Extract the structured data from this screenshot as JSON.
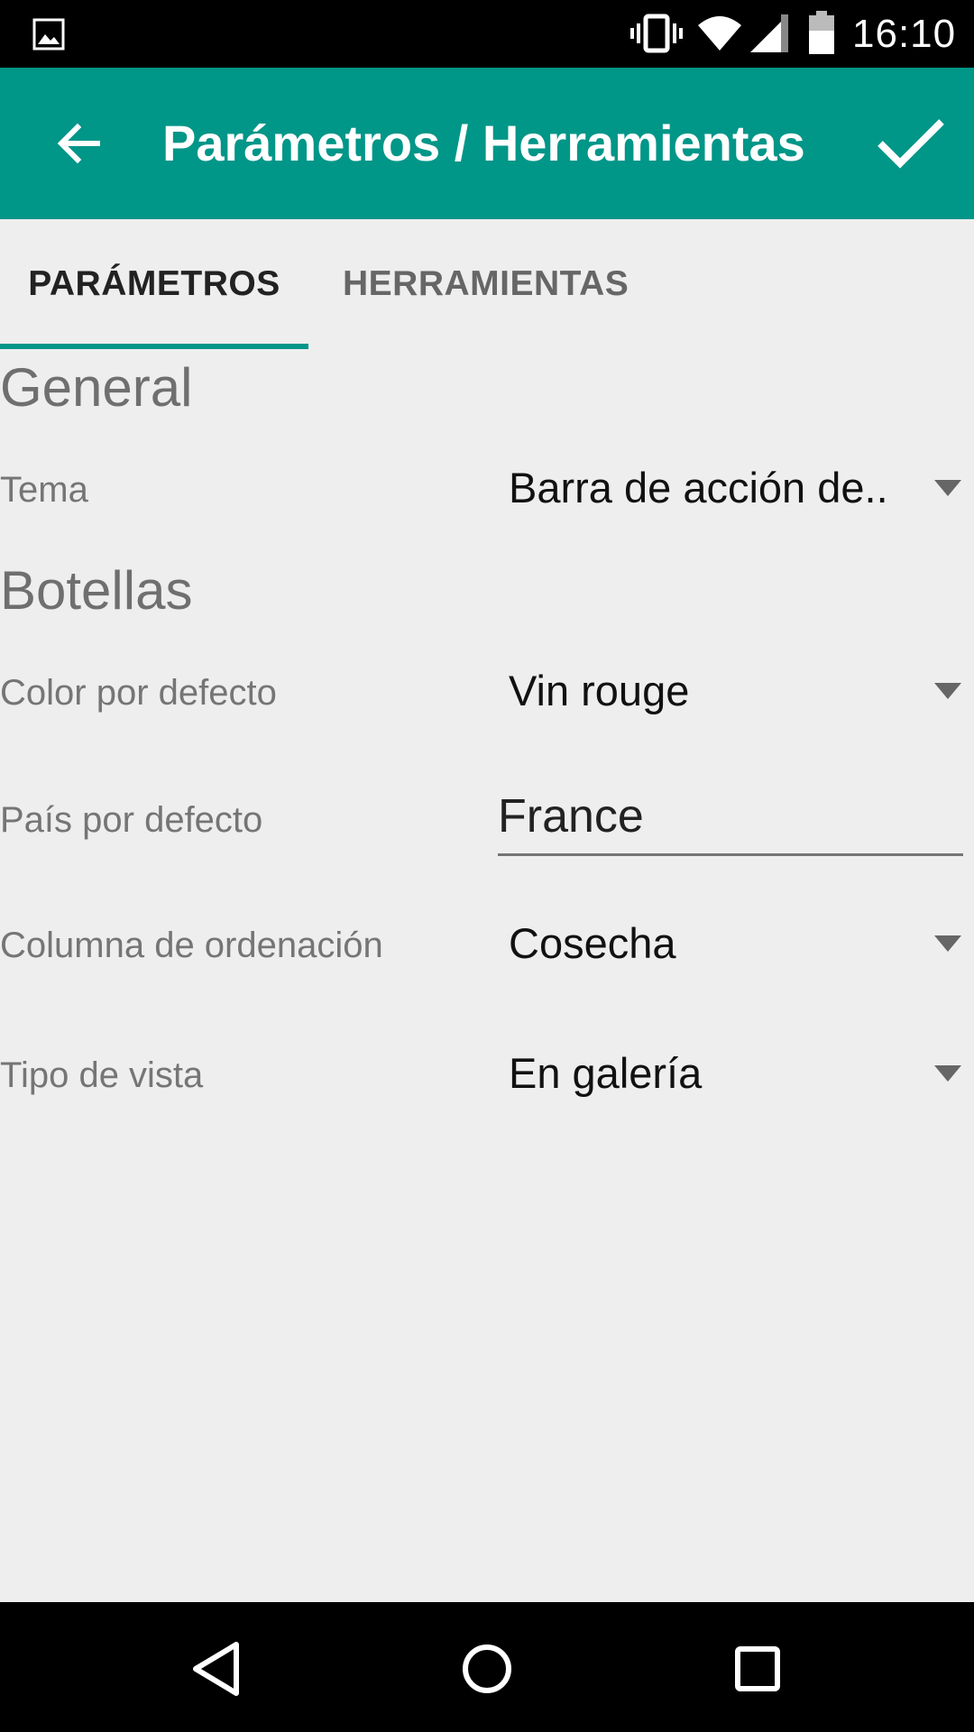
{
  "status_bar": {
    "time": "16:10",
    "icons": [
      "gallery-icon",
      "vibrate-icon",
      "wifi-icon",
      "signal-icon",
      "battery-icon"
    ]
  },
  "app_bar": {
    "title": "Parámetros / Herramientas",
    "background_color": "#009688",
    "back_icon": "arrow-back-icon",
    "confirm_icon": "check-icon"
  },
  "tabs": [
    {
      "label": "PARÁMETROS",
      "selected": true
    },
    {
      "label": "HERRAMIENTAS",
      "selected": false
    }
  ],
  "sections": {
    "general": {
      "title": "General",
      "settings": {
        "tema": {
          "label": "Tema",
          "value": "Barra de acción de.."
        }
      }
    },
    "botellas": {
      "title": "Botellas",
      "settings": {
        "color": {
          "label": "Color por defecto",
          "value": "Vin rouge"
        },
        "pais": {
          "label": "País por defecto",
          "value": "France"
        },
        "columna": {
          "label": "Columna de ordenación",
          "value": "Cosecha"
        },
        "vista": {
          "label": "Tipo de vista",
          "value": "En galería"
        }
      }
    }
  },
  "nav_bar": {
    "icons": [
      "back-nav-icon",
      "home-nav-icon",
      "recents-nav-icon"
    ]
  }
}
